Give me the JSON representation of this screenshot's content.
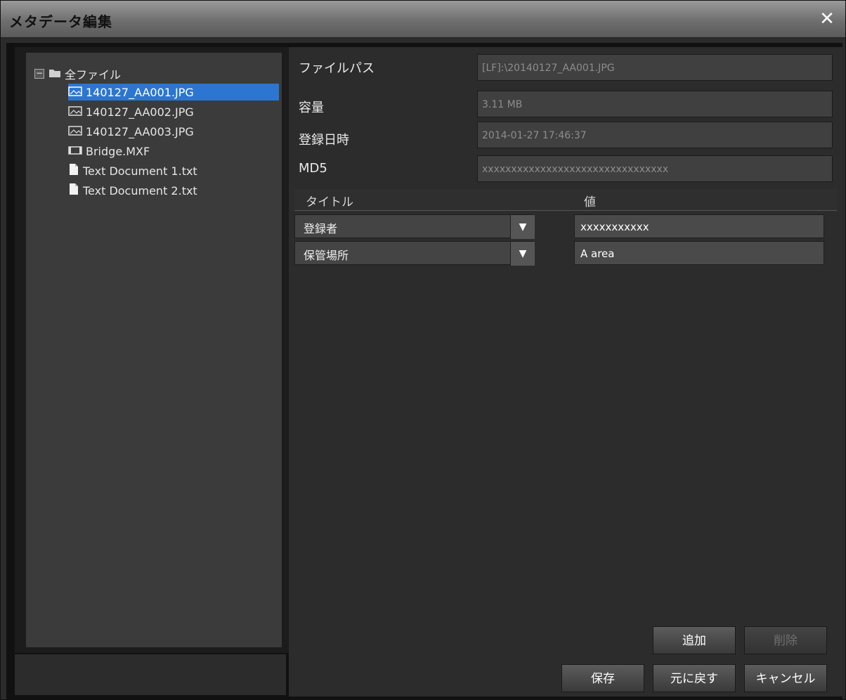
{
  "window": {
    "title": "メタデータ編集",
    "close_label": "✕"
  },
  "tree": {
    "root": {
      "expander": "−",
      "label": "全ファイル"
    },
    "items": [
      {
        "label": "140127_AA001.JPG",
        "type": "image",
        "selected": true
      },
      {
        "label": "140127_AA002.JPG",
        "type": "image",
        "selected": false
      },
      {
        "label": "140127_AA003.JPG",
        "type": "image",
        "selected": false
      },
      {
        "label": "Bridge.MXF",
        "type": "video",
        "selected": false
      },
      {
        "label": "Text Document 1.txt",
        "type": "document",
        "selected": false
      },
      {
        "label": "Text Document 2.txt",
        "type": "document",
        "selected": false
      }
    ]
  },
  "properties": [
    {
      "label": "ファイルパス",
      "value": "[LF]:\\20140127_AA001.JPG"
    },
    {
      "label": "容量",
      "value": "3.11 MB"
    },
    {
      "label": "登録日時",
      "value": "2014-01-27 17:46:37"
    },
    {
      "label": "MD5",
      "value": "xxxxxxxxxxxxxxxxxxxxxxxxxxxxxxxx"
    }
  ],
  "grid": {
    "header_title": "タイトル",
    "header_value": "値",
    "rows": [
      {
        "title": "登録者",
        "value": "xxxxxxxxxxx"
      },
      {
        "title": "保管場所",
        "value": "A area"
      }
    ],
    "dropdown_glyph": "▼"
  },
  "buttons": {
    "add": "追加",
    "delete": "削除",
    "save": "保存",
    "revert": "元に戻す",
    "cancel": "キャンセル"
  }
}
